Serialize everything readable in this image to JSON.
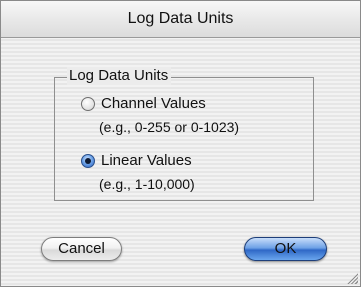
{
  "window": {
    "title": "Log Data Units"
  },
  "group": {
    "title": "Log Data Units",
    "options": [
      {
        "label": "Channel Values",
        "hint": "(e.g., 0-255 or 0-1023)",
        "selected": false
      },
      {
        "label": "Linear Values",
        "hint": "(e.g., 1-10,000)",
        "selected": true
      }
    ]
  },
  "buttons": {
    "cancel_label": "Cancel",
    "ok_label": "OK"
  },
  "colors": {
    "default_button": "#2f68c7",
    "selected_radio": "#2c63c2"
  }
}
